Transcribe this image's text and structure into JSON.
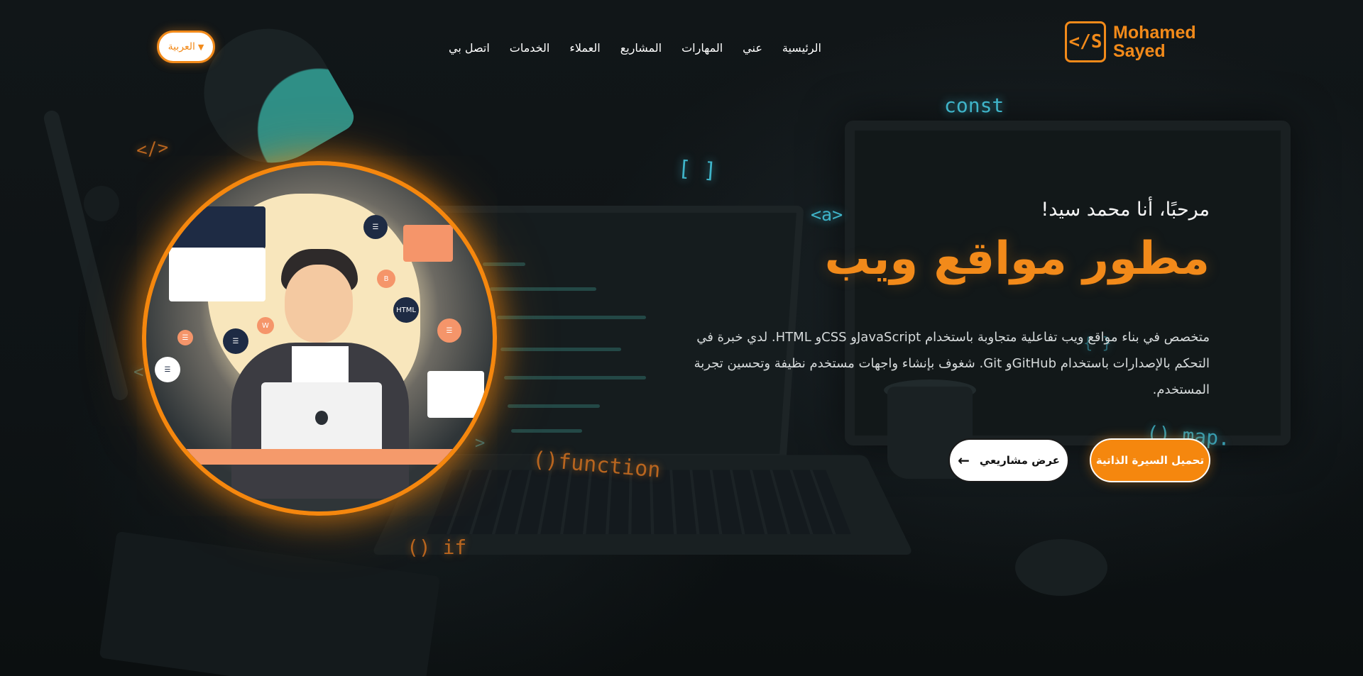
{
  "logo": {
    "mark": "</S",
    "name_line1": "Mohamed",
    "name_line2": "Sayed"
  },
  "nav": {
    "items": [
      "الرئيسية",
      "عني",
      "المهارات",
      "المشاريع",
      "العملاء",
      "الخدمات",
      "اتصل بي"
    ]
  },
  "language": {
    "label": "العربية",
    "caret": "▼"
  },
  "hero": {
    "greeting": "مرحبًا، أنا محمد سيد!",
    "title": "مطور مواقع ويب",
    "description": "متخصص في بناء مواقع ويب تفاعلية متجاوبة باستخدام JavaScriptو CSSو HTML. لدي خبرة في التحكم بالإصدارات باستخدام GitHubو Git. شغوف بإنشاء واجهات مستخدم نظيفة وتحسين تجربة المستخدم.",
    "cv_button": "تحميل السيرة الذاتية",
    "projects_button": "عرض مشاريعي",
    "projects_arrow": "←"
  },
  "code_glyphs": {
    "const": "const",
    "brackets": "[ ]",
    "anchor": "<a>",
    "closing_tag": "</>",
    "function": "()function",
    "if": "() if",
    "map": "().map.",
    "chevron": "/ >",
    "braces": "{ }",
    "less": "<"
  },
  "avatar": {
    "html_badge": "HTML"
  },
  "colors": {
    "accent": "#f5870e",
    "background": "#0d1113",
    "glyph_cyan": "#3fb4c9"
  }
}
